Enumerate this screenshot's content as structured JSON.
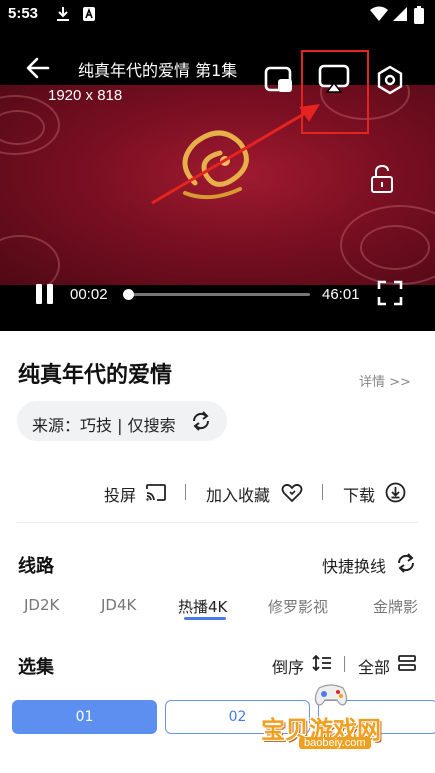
{
  "status_bar": {
    "time": "5:53",
    "icons": [
      "download-icon",
      "app-notification-icon",
      "wifi-icon",
      "cellular-signal-icon",
      "battery-icon"
    ]
  },
  "player": {
    "title": "纯真年代的爱情 第1集",
    "resolution": "1920 x 818",
    "current_time": "00:02",
    "duration": "46:01",
    "progress_fraction": 0.001,
    "state": "playing",
    "annotation_color": "#e5231f",
    "icons": [
      "back-arrow-icon",
      "picture-in-picture-icon",
      "screen-cast-icon",
      "settings-icon",
      "lock-icon",
      "pause-icon",
      "fullscreen-icon"
    ]
  },
  "show": {
    "title": "纯真年代的爱情",
    "details_link": "详情 >>",
    "source_label": "来源：巧技 | 仅搜索"
  },
  "actions": [
    {
      "label": "投屏",
      "icon": "cast-icon"
    },
    {
      "label": "加入收藏",
      "icon": "heart-icon"
    },
    {
      "label": "下载",
      "icon": "download-circle-icon"
    }
  ],
  "routes": {
    "section_title": "线路",
    "quick_switch": "快捷换线",
    "tabs": [
      "JD2K",
      "JD4K",
      "热播4K",
      "修罗影视",
      "金牌影"
    ],
    "active_index": 2,
    "accent": "#4a7be8"
  },
  "episodes": {
    "section_title": "选集",
    "sort_label": "倒序",
    "all_label": "全部",
    "items": [
      "01",
      "02",
      ""
    ],
    "active_index": 0
  },
  "watermark": {
    "title": "宝贝游戏网",
    "url": "baobeiy.com"
  }
}
